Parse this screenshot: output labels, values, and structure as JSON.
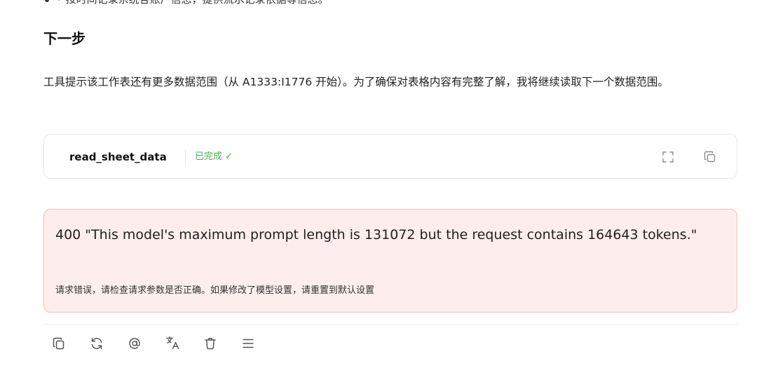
{
  "previous": {
    "partial_text": "• 按时间记录系统各账户信息，提供流水记录依据等信息。"
  },
  "section": {
    "title": "下一步",
    "paragraph": "工具提示该工作表还有更多数据范围（从 A1333:I1776 开始）。为了确保对表格内容有完整了解，我将继续读取下一个数据范围。"
  },
  "tool_call": {
    "name": "read_sheet_data",
    "status": "已完成 ✓",
    "status_color": "#4caf50",
    "icons": [
      "expand-icon",
      "copy-icon"
    ]
  },
  "error": {
    "message": "400 \"This model's maximum prompt length is 131072 but the request contains 164643 tokens.\"",
    "hint": "请求错误，请检查请求参数是否正确。如果修改了模型设置，请重置到默认设置",
    "background": "#fdeeed",
    "border": "#f3c1bf"
  },
  "actions": [
    "copy-icon",
    "regenerate-icon",
    "mention-icon",
    "translate-icon",
    "delete-icon",
    "more-menu-icon"
  ]
}
